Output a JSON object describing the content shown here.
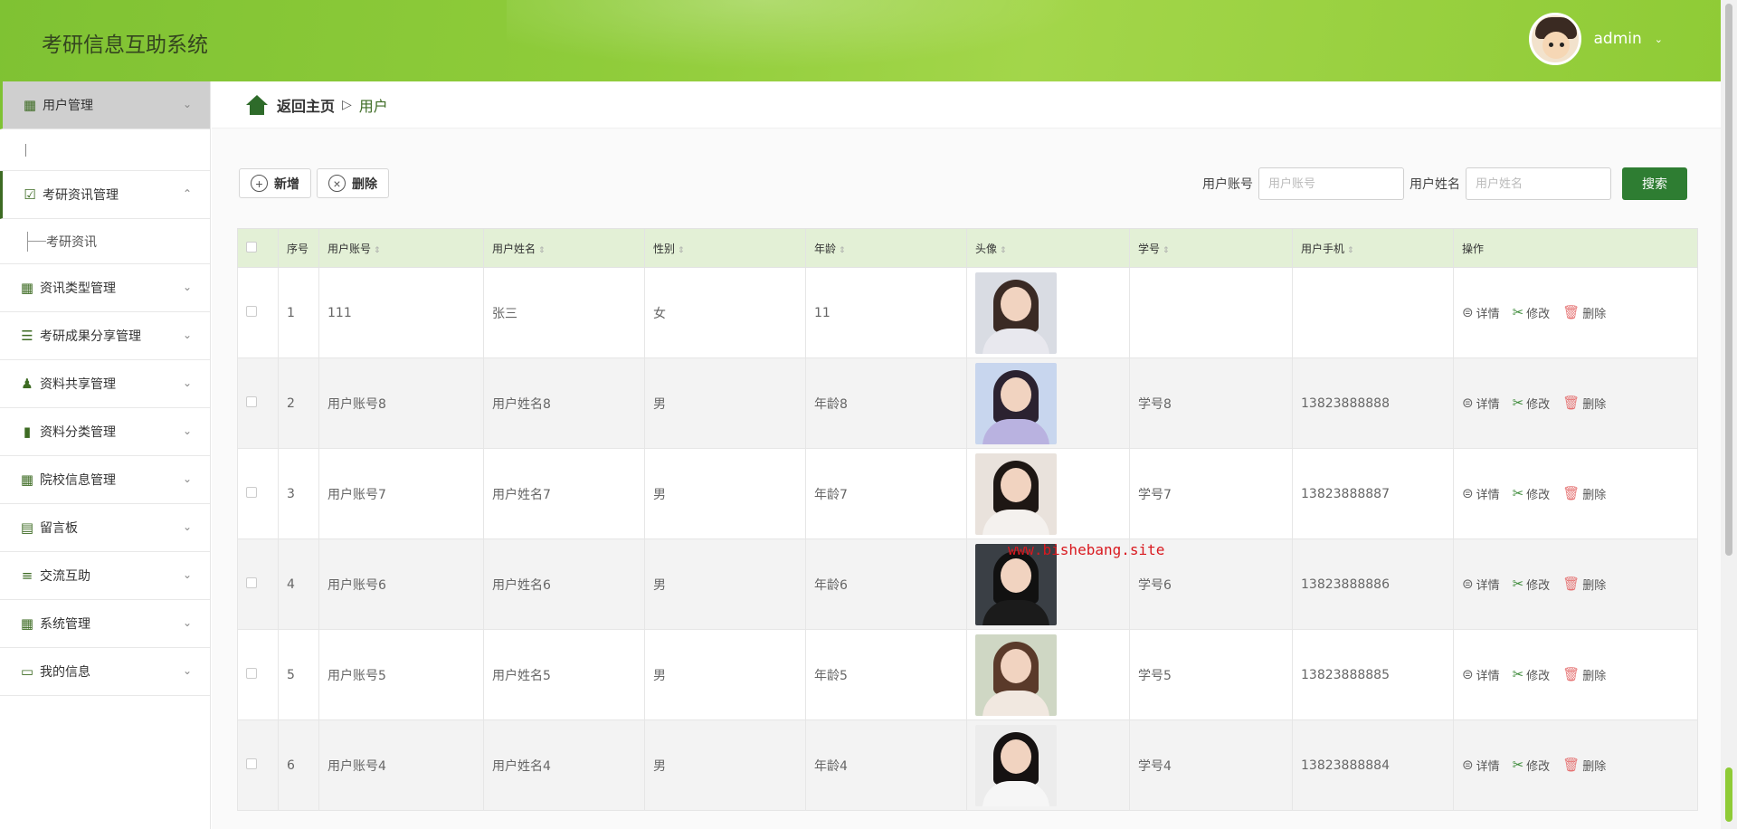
{
  "app": {
    "title": "考研信息互助系统"
  },
  "user": {
    "name": "admin",
    "caret": "⌄"
  },
  "sidebar": {
    "items": [
      {
        "label": "用户管理",
        "icon": "grid-icon",
        "glyph": "▦"
      },
      {
        "label": "考研资讯管理",
        "icon": "clipboard-check-icon",
        "glyph": "☑"
      },
      {
        "label": "资讯类型管理",
        "icon": "grid-icon",
        "glyph": "▦"
      },
      {
        "label": "考研成果分享管理",
        "icon": "list-icon",
        "glyph": "☰"
      },
      {
        "label": "资料共享管理",
        "icon": "user-icon",
        "glyph": "♟"
      },
      {
        "label": "资料分类管理",
        "icon": "bar-chart-icon",
        "glyph": "▮"
      },
      {
        "label": "院校信息管理",
        "icon": "grid-icon",
        "glyph": "▦"
      },
      {
        "label": "留言板",
        "icon": "briefcase-icon",
        "glyph": "▤"
      },
      {
        "label": "交流互助",
        "icon": "sliders-icon",
        "glyph": "≡"
      },
      {
        "label": "系统管理",
        "icon": "grid-icon",
        "glyph": "▦"
      },
      {
        "label": "我的信息",
        "icon": "card-icon",
        "glyph": "▭"
      }
    ],
    "sub_item_label": "考研资讯",
    "arrow_down": "⌄",
    "arrow_up": "⌃"
  },
  "breadcrumb": {
    "home": "返回主页",
    "separator": "▷",
    "current": "用户"
  },
  "toolbar": {
    "add_label": "新增",
    "add_glyph": "+",
    "delete_label": "删除",
    "delete_glyph": "×"
  },
  "search": {
    "account_label": "用户账号",
    "account_placeholder": "用户账号",
    "name_label": "用户姓名",
    "name_placeholder": "用户姓名",
    "button_label": "搜索"
  },
  "table": {
    "columns": [
      "序号",
      "用户账号",
      "用户姓名",
      "性别",
      "年龄",
      "头像",
      "学号",
      "用户手机",
      "操作"
    ],
    "sort_glyph": "⇕",
    "rows": [
      {
        "index": "1",
        "account": "111",
        "name": "张三",
        "gender": "女",
        "age": "11",
        "student_id": "",
        "phone": ""
      },
      {
        "index": "2",
        "account": "用户账号8",
        "name": "用户姓名8",
        "gender": "男",
        "age": "年龄8",
        "student_id": "学号8",
        "phone": "13823888888"
      },
      {
        "index": "3",
        "account": "用户账号7",
        "name": "用户姓名7",
        "gender": "男",
        "age": "年龄7",
        "student_id": "学号7",
        "phone": "13823888887"
      },
      {
        "index": "4",
        "account": "用户账号6",
        "name": "用户姓名6",
        "gender": "男",
        "age": "年龄6",
        "student_id": "学号6",
        "phone": "13823888886"
      },
      {
        "index": "5",
        "account": "用户账号5",
        "name": "用户姓名5",
        "gender": "男",
        "age": "年龄5",
        "student_id": "学号5",
        "phone": "13823888885"
      },
      {
        "index": "6",
        "account": "用户账号4",
        "name": "用户姓名4",
        "gender": "男",
        "age": "年龄4",
        "student_id": "学号4",
        "phone": "13823888884"
      }
    ],
    "actions": {
      "detail": "详情",
      "edit": "修改",
      "delete": "删除",
      "detail_glyph": "⊜",
      "edit_glyph": "✂",
      "delete_glyph": "🗑"
    }
  },
  "watermark": "www.bishebang.site",
  "colors": {
    "header": "#8fcb36",
    "accent": "#2e7d32",
    "table_header": "#e3f0d6"
  }
}
